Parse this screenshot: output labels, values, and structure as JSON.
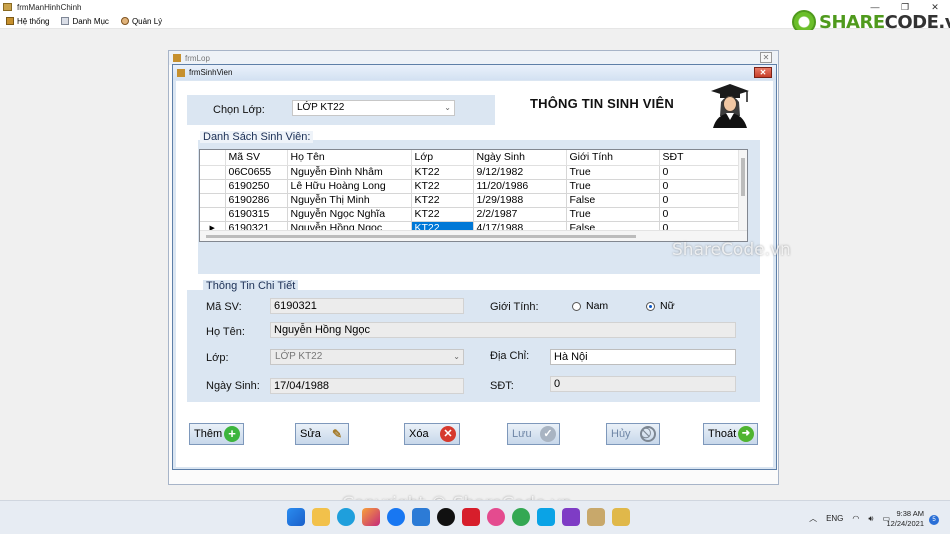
{
  "app": {
    "title": "frmManHinhChinh"
  },
  "menu": [
    {
      "label": "Hệ thống"
    },
    {
      "label": "Danh Mục"
    },
    {
      "label": "Quản Lý"
    }
  ],
  "logo": {
    "brand_green": "SHARE",
    "brand_dark": "CODE.vn"
  },
  "outer_window": {
    "title": "frmLop"
  },
  "form": {
    "title": "frmSinhVien",
    "class_label": "Chọn Lớp:",
    "class_value": "LỚP KT22",
    "heading": "THÔNG TIN SINH VIÊN",
    "list_title": "Danh Sách Sinh Viên:",
    "detail_title": "Thông Tin Chi Tiết"
  },
  "grid": {
    "columns": [
      "Mã SV",
      "Họ Tên",
      "Lớp",
      "Ngày Sinh",
      "Giới Tính",
      "SĐT"
    ],
    "rows": [
      [
        "06C0655",
        "Nguyễn Đình Nhâm",
        "KT22",
        "9/12/1982",
        "True",
        "0"
      ],
      [
        "6190250",
        "Lê Hữu Hoàng Long",
        "KT22",
        "11/20/1986",
        "True",
        "0"
      ],
      [
        "6190286",
        "Nguyễn Thị Minh",
        "KT22",
        "1/29/1988",
        "False",
        "0"
      ],
      [
        "6190315",
        "Nguyễn Ngọc Nghĩa",
        "KT22",
        "2/2/1987",
        "True",
        "0"
      ],
      [
        "6190321",
        "Nguyễn Hồng Ngọc",
        "KT22",
        "4/17/1988",
        "False",
        "0"
      ]
    ],
    "selected_row": 4
  },
  "detail": {
    "masv_label": "Mã SV:",
    "masv_value": "6190321",
    "gender_label": "Giới Tính:",
    "gender_male": "Nam",
    "gender_female": "Nữ",
    "gender_selected": "Nữ",
    "name_label": "Họ Tên:",
    "name_value": "Nguyễn Hồng Ngọc",
    "class_label": "Lớp:",
    "class_value": "LỚP KT22",
    "address_label": "Địa Chỉ:",
    "address_value": "Hà Nội",
    "dob_label": "Ngày Sinh:",
    "dob_value": "17/04/1988",
    "phone_label": "SĐT:",
    "phone_value": "0"
  },
  "buttons": {
    "add": "Thêm",
    "edit": "Sửa",
    "delete": "Xóa",
    "save": "Lưu",
    "cancel": "Hủy",
    "exit": "Thoát"
  },
  "watermark": {
    "text1": "ShareCode.vn",
    "text2": "Copyright © ShareCode.vn"
  },
  "taskbar": {
    "lang": "ENG",
    "time": "9:38 AM",
    "date": "12/24/2021",
    "notifications": "5"
  },
  "colors": {
    "form_bg": "#dbe6f2",
    "selection": "#0078d7",
    "add_icon": "#3db53d",
    "delete_icon": "#d63a2e",
    "exit_icon": "#4fb430"
  }
}
